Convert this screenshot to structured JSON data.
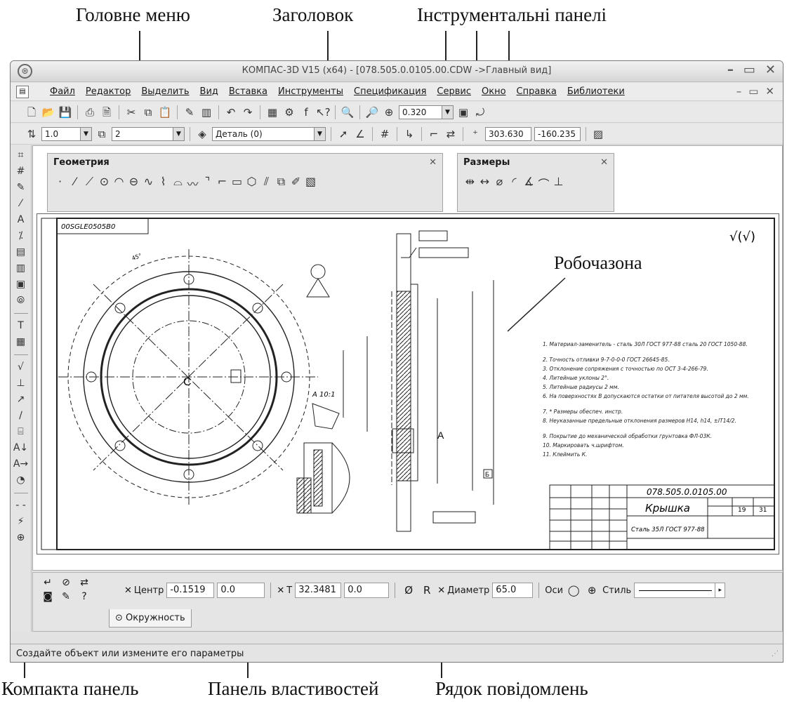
{
  "annotations": {
    "main_menu": "Головне меню",
    "title": "Заголовок",
    "toolbars": "Інструментальні панелі",
    "workarea": "Робочазона",
    "compact_panel": "Компакта панель",
    "props_panel": "Панель властивостей",
    "message_line": "Рядок повідомлень"
  },
  "window": {
    "title": "КОМПАС-3D V15 (x64) - [078.505.0.0105.00.CDW ->Главный вид]",
    "app_icon": "compass-logo-icon",
    "controls": [
      "minimize-icon",
      "maximize-icon",
      "close-icon"
    ]
  },
  "menu": {
    "items": [
      "Файл",
      "Редактор",
      "Выделить",
      "Вид",
      "Вставка",
      "Инструменты",
      "Спецификация",
      "Сервис",
      "Окно",
      "Справка",
      "Библиотеки"
    ]
  },
  "toolbar1": {
    "zoom": "0.320"
  },
  "toolbar2": {
    "step": "1.0",
    "layer": "2",
    "object": "Деталь (0)",
    "coord_x": "303.630",
    "coord_y": "-160.235"
  },
  "panels": {
    "geometry": "Геометрия",
    "dimensions": "Размеры"
  },
  "drawing": {
    "stamp_code": "078.505.0.0105.00",
    "stamp_name": "Крышка",
    "material": "Сталь 35Л ГОСТ 977-88",
    "sheet": "19",
    "sheets": "31",
    "section_label": "А",
    "view_letter": "Б",
    "roughness": "√(√)",
    "notes": [
      "1. Материал-заменитель - сталь 30Л ГОСТ 977-88 сталь 20 ГОСТ 1050-88.",
      "2. Точность отливки 9-7-0-0-0 ГОСТ 26645-85.",
      "3. Отклонение сопряжения с точностью по ОСТ 3-4-266-79.",
      "4. Литейные уклоны 2°.",
      "5. Литейные радиусы 2 мм.",
      "6. На поверхностях В допускаются остатки от питателя высотой до 2 мм.",
      "7. * Размеры обеспеч. инстр.",
      "8. Неуказанные предельные отклонения размеров H14, h14, ±IT14/2.",
      "9. Покрытие до механической обработки грунтовка ФЛ-03К.",
      "10. Маркировать ч.шрифтом.",
      "11. Клеймить К."
    ]
  },
  "props": {
    "center_label": "Центр",
    "center_x": "-0.1519",
    "center_y": "0.0",
    "point_label": "Т",
    "point_x": "32.3481",
    "point_y": "0.0",
    "diameter_symbol": "Ø",
    "radius_symbol": "R",
    "diameter_label": "Диаметр",
    "diameter_value": "65.0",
    "axes_label": "Оси",
    "style_label": "Стиль",
    "tab_label": "Окружность"
  },
  "status": {
    "message": "Создайте объект или измените его параметры"
  }
}
